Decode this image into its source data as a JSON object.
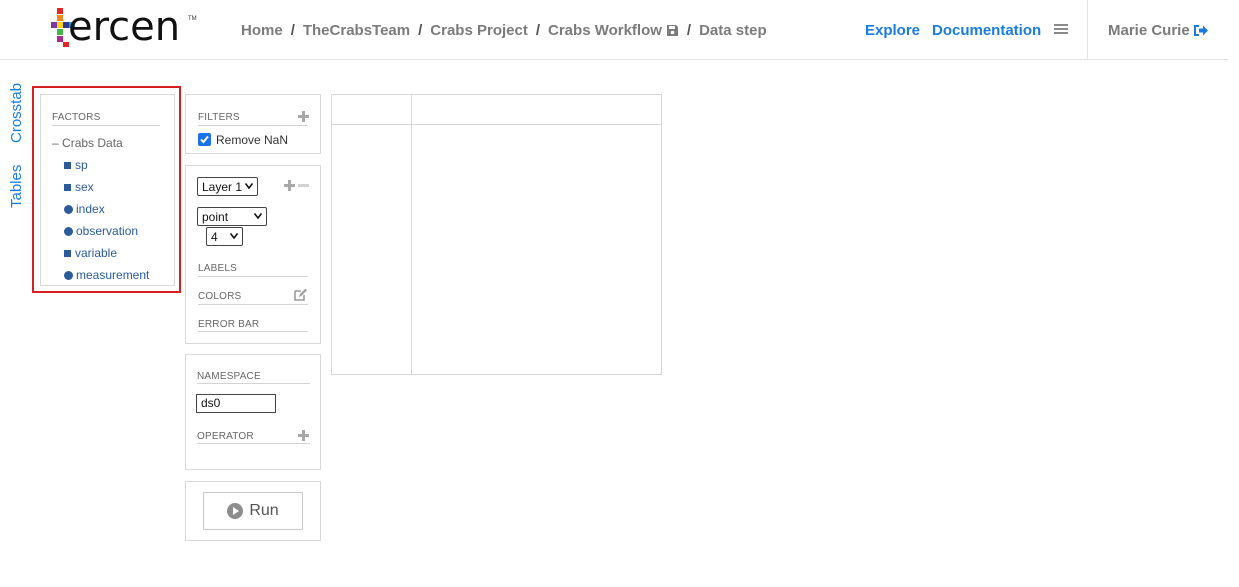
{
  "header": {
    "logo_text": "ercen",
    "logo_tm": "TM",
    "breadcrumb": [
      "Home",
      "TheCrabsTeam",
      "Crabs Project",
      "Crabs Workflow",
      "Data step"
    ],
    "separator": "/",
    "links": {
      "explore": "Explore",
      "documentation": "Documentation"
    },
    "user": "Marie Curie",
    "colors": {
      "link": "#1a7ce0",
      "muted": "#7b7b7b"
    }
  },
  "side_tabs": {
    "crosstab": "Crosstab",
    "tables": "Tables"
  },
  "factors": {
    "title": "FACTORS",
    "dataset": "Crabs Data",
    "collapse_symbol": "–",
    "items": [
      {
        "label": "sp",
        "icon": "square-icon"
      },
      {
        "label": "sex",
        "icon": "square-icon"
      },
      {
        "label": "index",
        "icon": "circle-icon"
      },
      {
        "label": "observation",
        "icon": "circle-icon"
      },
      {
        "label": "variable",
        "icon": "square-icon"
      },
      {
        "label": "measurement",
        "icon": "circle-icon"
      }
    ],
    "highlight_color": "#d71f1f"
  },
  "filters": {
    "title": "FILTERS",
    "remove_nan_label": "Remove NaN",
    "remove_nan_checked": true
  },
  "layer": {
    "layer_select": "Layer 1",
    "chart_type_select": "point",
    "size_select": "4",
    "labels_title": "LABELS",
    "colors_title": "COLORS",
    "error_bar_title": "ERROR BAR"
  },
  "operator_panel": {
    "namespace_title": "NAMESPACE",
    "namespace_value": "ds0",
    "operator_title": "OPERATOR"
  },
  "run": {
    "label": "Run"
  }
}
